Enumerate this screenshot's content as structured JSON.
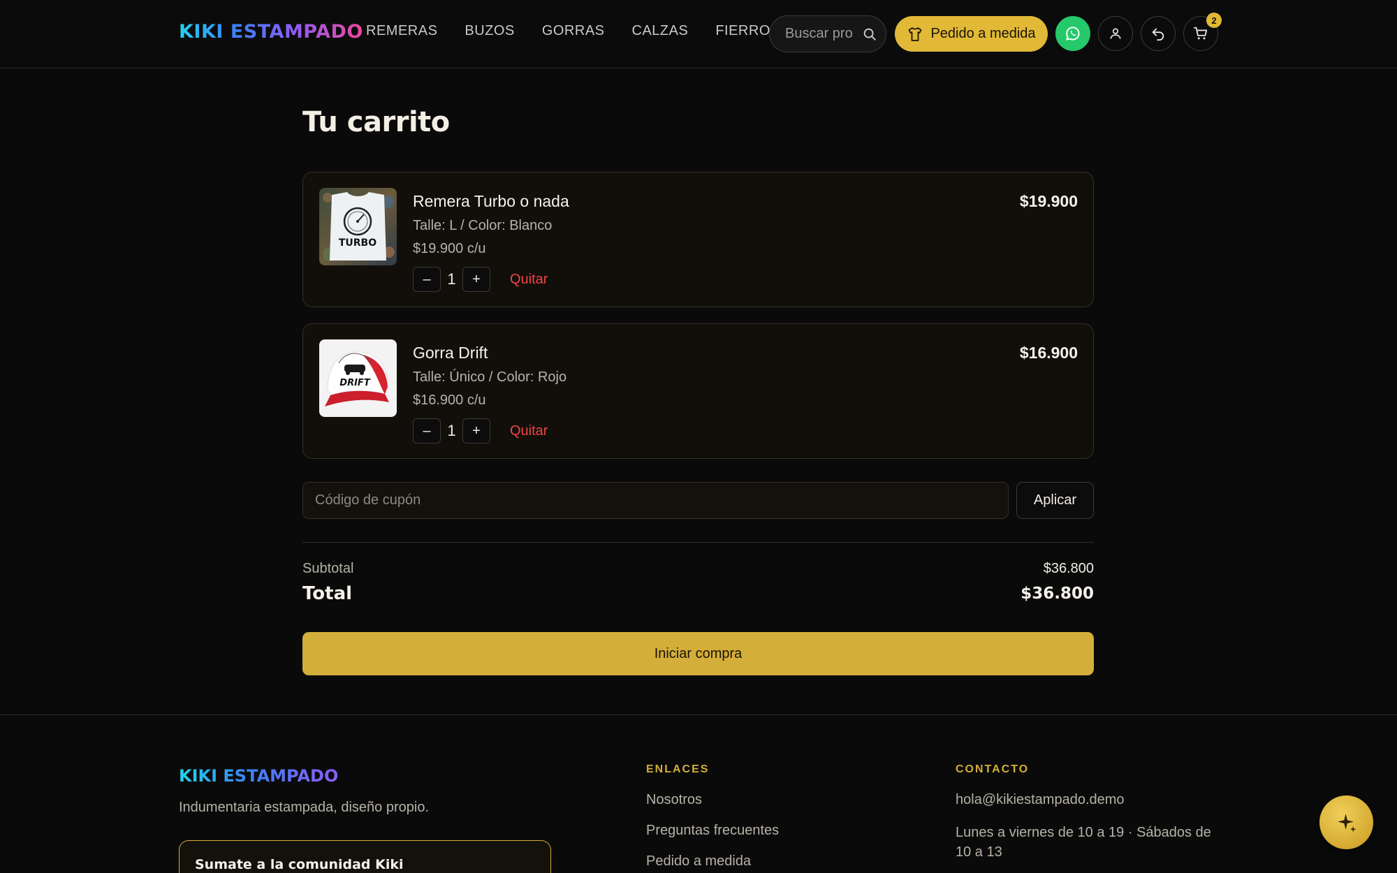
{
  "header": {
    "logo": "KIKI ESTAMPADO",
    "nav": [
      "REMERAS",
      "BUZOS",
      "GORRAS",
      "CALZAS",
      "FIERROS"
    ],
    "search_placeholder": "Buscar productos",
    "custom_order_label": "Pedido a medida",
    "cart_count": "2"
  },
  "cart": {
    "title": "Tu carrito",
    "items": [
      {
        "name": "Remera Turbo o nada",
        "variant": "Talle: L / Color: Blanco",
        "unit_price": "$19.900 c/u",
        "quantity": "1",
        "price": "$19.900",
        "remove_label": "Quitar",
        "image_text": "TURBO"
      },
      {
        "name": "Gorra Drift",
        "variant": "Talle: Único / Color: Rojo",
        "unit_price": "$16.900 c/u",
        "quantity": "1",
        "price": "$16.900",
        "remove_label": "Quitar",
        "image_text": "DRIFT"
      }
    ],
    "minus": "–",
    "plus": "+",
    "coupon_placeholder": "Código de cupón",
    "apply_label": "Aplicar",
    "subtotal_label": "Subtotal",
    "subtotal_value": "$36.800",
    "total_label": "Total",
    "total_value": "$36.800",
    "checkout_label": "Iniciar compra"
  },
  "footer": {
    "logo": "KIKI ESTAMPADO",
    "tagline": "Indumentaria estampada, diseño propio.",
    "community_title": "Sumate a la comunidad Kiki",
    "links_heading": "ENLACES",
    "links": [
      "Nosotros",
      "Preguntas frecuentes",
      "Pedido a medida"
    ],
    "contact_heading": "CONTACTO",
    "email": "hola@kikiestampado.demo",
    "hours": "Lunes a viernes de 10 a 19 · Sábados de 10 a 13"
  },
  "colors": {
    "background": "#0a0a0a",
    "accent_gold": "#d4ae3a",
    "whatsapp_green": "#25c96a",
    "remove_red": "#ef4444"
  },
  "icons": [
    "search-icon",
    "shirt-icon",
    "whatsapp-icon",
    "user-icon",
    "back-arrow-icon",
    "cart-icon",
    "sparkle-icon"
  ]
}
